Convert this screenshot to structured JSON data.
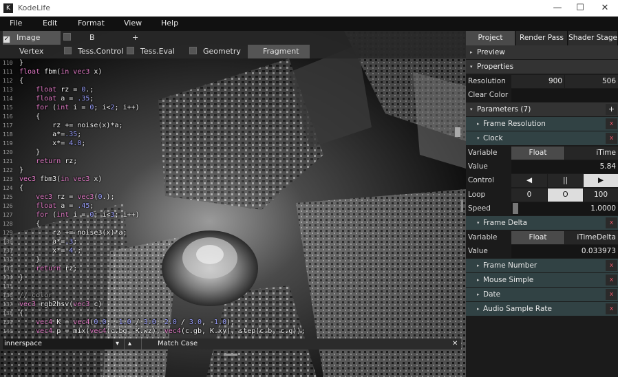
{
  "window": {
    "title": "KodeLife",
    "logo_glyph": "K",
    "minimize": "—",
    "maximize": "☐",
    "close": "✕"
  },
  "menu": [
    "File",
    "Edit",
    "Format",
    "View",
    "Help"
  ],
  "doc_tabs": {
    "image": "Image",
    "b": "B",
    "add": "+"
  },
  "stage_tabs": {
    "vertex": "Vertex",
    "tess_control": "Tess.Control",
    "tess_eval": "Tess.Eval",
    "geometry": "Geometry",
    "fragment": "Fragment"
  },
  "code_lines": [
    {
      "n": "110",
      "t": "}"
    },
    {
      "n": "111",
      "t": "float fbm(in vec3 x)"
    },
    {
      "n": "112",
      "t": "{"
    },
    {
      "n": "113",
      "t": "    float rz = 0.;"
    },
    {
      "n": "114",
      "t": "    float a = .35;"
    },
    {
      "n": "115",
      "t": "    for (int i = 0; i<2; i++)"
    },
    {
      "n": "116",
      "t": "    {"
    },
    {
      "n": "117",
      "t": "        rz += noise(x)*a;"
    },
    {
      "n": "118",
      "t": "        a*=.35;"
    },
    {
      "n": "119",
      "t": "        x*= 4.0;"
    },
    {
      "n": "120",
      "t": "    }"
    },
    {
      "n": "121",
      "t": "    return rz;"
    },
    {
      "n": "122",
      "t": "}"
    },
    {
      "n": "123",
      "t": "vec3 fbm3(in vec3 x)"
    },
    {
      "n": "124",
      "t": "{"
    },
    {
      "n": "125",
      "t": "    vec3 rz = vec3(0.);"
    },
    {
      "n": "126",
      "t": "    float a = .45;"
    },
    {
      "n": "127",
      "t": "    for (int i = 0; i<3; i++)"
    },
    {
      "n": "128",
      "t": "    {"
    },
    {
      "n": "129",
      "t": "        rz += noise3(x)*a;"
    },
    {
      "n": "130",
      "t": "        a*=.3;"
    },
    {
      "n": "131",
      "t": "        x*= 4.;"
    },
    {
      "n": "132",
      "t": "    }"
    },
    {
      "n": "133",
      "t": "    return rz;"
    },
    {
      "n": "134",
      "t": "}"
    },
    {
      "n": "135",
      "t": ""
    },
    {
      "n": "136",
      "t": "// color"
    },
    {
      "n": "137",
      "t": "vec3 rgb2hsv(vec3 c)"
    },
    {
      "n": "138",
      "t": "{"
    },
    {
      "n": "139",
      "t": "    vec4 K = vec4(0.0, -1.0 / 3.0, 2.0 / 3.0, -1.0);"
    },
    {
      "n": "140",
      "t": "    vec4 p = mix(vec4(c.bg, K.wz), vec4(c.gb, K.xy), step(c.b, c.g));"
    }
  ],
  "find": {
    "query": "innerspace",
    "dropdown": "▾",
    "up": "▴",
    "match_case": "Match Case",
    "close": "✕"
  },
  "panel": {
    "tabs": {
      "project": "Project",
      "render_pass": "Render Pass",
      "shader_stage": "Shader Stage"
    },
    "preview": "Preview",
    "properties": "Properties",
    "resolution_label": "Resolution",
    "resolution_w": "900",
    "resolution_h": "506",
    "clear_color_label": "Clear Color",
    "parameters": "Parameters (7)",
    "params_add": "+",
    "frame_resolution": "Frame Resolution",
    "clock": {
      "title": "Clock",
      "variable_label": "Variable",
      "type": "Float",
      "name": "iTime",
      "value_label": "Value",
      "value": "5.84",
      "control_label": "Control",
      "rewind": "◀",
      "pause": "||",
      "play": "▶",
      "loop_label": "Loop",
      "loop_start": "0",
      "loop_mid": "O",
      "loop_end": "100",
      "speed_label": "Speed",
      "speed": "1.0000"
    },
    "frame_delta": {
      "title": "Frame Delta",
      "variable_label": "Variable",
      "type": "Float",
      "name": "iTimeDelta",
      "value_label": "Value",
      "value": "0.033973"
    },
    "frame_number": "Frame Number",
    "mouse_simple": "Mouse Simple",
    "date": "Date",
    "audio_sample_rate": "Audio Sample Rate",
    "remove_glyph": "x",
    "arrow_right": "▸",
    "arrow_down": "▾"
  }
}
